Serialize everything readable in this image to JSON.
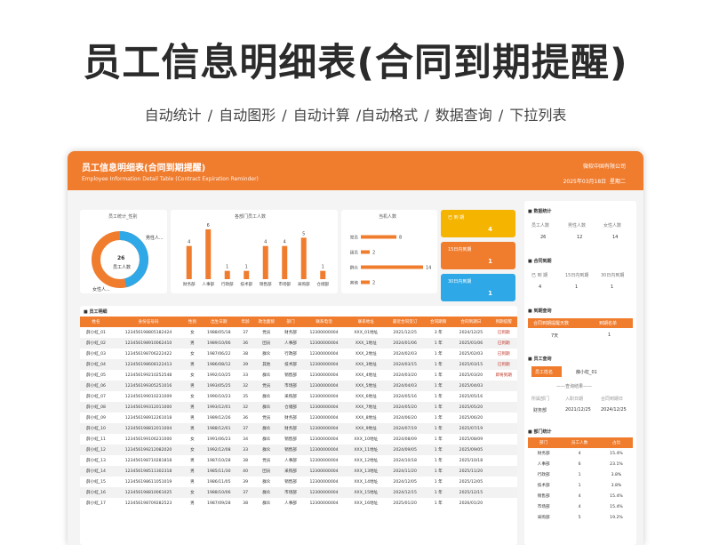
{
  "hero": {
    "title": "员工信息明细表(合同到期提醒)",
    "subtitle": "自动统计 / 自动图形 / 自动计算 /自动格式 / 数据查询 / 下拉列表"
  },
  "header": {
    "title": "员工信息明细表(合同到期提醒)",
    "subtitle": "Employee Information Detail Table (Contract Expiration Reminder)",
    "company": "微软中国有限公司",
    "date": "2025年03月18日",
    "weekday": "星期二"
  },
  "colors": {
    "accent": "#f07c2e",
    "blue": "#2ea8e6",
    "gold": "#f5b400"
  },
  "stats": {
    "gender": {
      "title": "员工统计_性别",
      "center_value": "26",
      "center_label": "员工人数",
      "male": "男性人...",
      "female": "女性人...",
      "male_count": 14,
      "female_count": 12
    },
    "dept": {
      "title": "各部门员工人数",
      "chart_data": {
        "type": "bar",
        "categories": [
          "财务部",
          "人事部",
          "行政部",
          "技术部",
          "销售部",
          "市场部",
          "采购部",
          "仓储部"
        ],
        "values": [
          4,
          6,
          1,
          1,
          4,
          4,
          5,
          1
        ]
      }
    },
    "intake": {
      "title": "当机人数",
      "chart_data": {
        "type": "bar",
        "orientation": "horizontal",
        "categories": [
          "党员",
          "团员",
          "群众",
          "其他"
        ],
        "values": [
          8,
          2,
          14,
          2
        ]
      }
    },
    "boxes": [
      {
        "label": "已 到 期",
        "value": "4"
      },
      {
        "label": "15日内到期",
        "value": "1"
      },
      {
        "label": "30日内到期",
        "value": "1"
      }
    ]
  },
  "table": {
    "title": "员工明细",
    "columns": [
      "姓名",
      "身份证号码",
      "性别",
      "出生日期",
      "年龄",
      "政治面貌",
      "部门",
      "联系电话",
      "联系地址",
      "最近合同签订",
      "合同期限",
      "合同到期日",
      "到期提醒"
    ],
    "rows": [
      [
        "薛小虹_01",
        "123456198805182424",
        "女",
        "1988/05/18",
        "37",
        "党员",
        "财务部",
        "12300000004",
        "XXX_01地址",
        "2021/12/25",
        "3 年",
        "2024/12/25",
        "已到期"
      ],
      [
        "薛小虹_02",
        "123456198910062410",
        "男",
        "1989/10/06",
        "36",
        "团员",
        "人事部",
        "12300000004",
        "XXX_1地址",
        "2024/01/06",
        "1 年",
        "2025/01/06",
        "已到期"
      ],
      [
        "薛小虹_03",
        "123456198706222422",
        "女",
        "1987/06/22",
        "38",
        "群众",
        "行政部",
        "12300000004",
        "XXX_2地址",
        "2024/02/03",
        "1 年",
        "2025/02/03",
        "已到期"
      ],
      [
        "薛小虹_04",
        "123456198608122413",
        "男",
        "1986/08/12",
        "39",
        "其他",
        "技术部",
        "12300000004",
        "XXX_3地址",
        "2024/03/15",
        "1 年",
        "2025/03/15",
        "已到期"
      ],
      [
        "薛小虹_05",
        "123456199210252548",
        "女",
        "1992/10/25",
        "33",
        "群众",
        "销售部",
        "12300000004",
        "XXX_4地址",
        "2024/03/20",
        "1 年",
        "2025/03/20",
        "即将到期"
      ],
      [
        "薛小虹_06",
        "123456199305251016",
        "男",
        "1993/05/25",
        "32",
        "党员",
        "市场部",
        "12300000004",
        "XXX_5地址",
        "2024/04/03",
        "1 年",
        "2025/04/03",
        ""
      ],
      [
        "薛小虹_07",
        "123456199010231009",
        "女",
        "1990/10/23",
        "35",
        "群众",
        "采购部",
        "12300000004",
        "XXX_6地址",
        "2024/05/16",
        "1 年",
        "2025/05/16",
        ""
      ],
      [
        "薛小虹_08",
        "123456199312011000",
        "男",
        "1993/12/01",
        "32",
        "群众",
        "仓储部",
        "12300000004",
        "XXX_7地址",
        "2024/05/20",
        "1 年",
        "2025/05/20",
        ""
      ],
      [
        "薛小虹_09",
        "123456198912261018",
        "男",
        "1989/12/26",
        "36",
        "党员",
        "财务部",
        "12300000004",
        "XXX_8地址",
        "2024/06/20",
        "1 年",
        "2025/06/20",
        ""
      ],
      [
        "薛小虹_10",
        "123456198812011004",
        "男",
        "1988/12/01",
        "37",
        "群众",
        "财务部",
        "12300000004",
        "XXX_9地址",
        "2024/07/19",
        "1 年",
        "2025/07/19",
        ""
      ],
      [
        "薛小虹_11",
        "123456199106231000",
        "女",
        "1991/06/23",
        "34",
        "群众",
        "销售部",
        "12300000004",
        "XXX_10地址",
        "2024/08/09",
        "1 年",
        "2025/08/09",
        ""
      ],
      [
        "薛小虹_12",
        "123456199212082020",
        "女",
        "1992/12/08",
        "33",
        "群众",
        "销售部",
        "12300000004",
        "XXX_11地址",
        "2024/09/05",
        "1 年",
        "2025/09/05",
        ""
      ],
      [
        "薛小虹_13",
        "123456198710281818",
        "男",
        "1987/10/28",
        "38",
        "党员",
        "人事部",
        "12300000004",
        "XXX_12地址",
        "2024/10/18",
        "1 年",
        "2025/10/18",
        ""
      ],
      [
        "薛小虹_14",
        "123456198511302318",
        "男",
        "1985/11/30",
        "40",
        "团员",
        "采购部",
        "12300000004",
        "XXX_13地址",
        "2024/11/20",
        "1 年",
        "2025/11/20",
        ""
      ],
      [
        "薛小虹_15",
        "123456198611051019",
        "男",
        "1986/11/05",
        "39",
        "群众",
        "销售部",
        "12300000004",
        "XXX_14地址",
        "2024/12/05",
        "1 年",
        "2025/12/05",
        ""
      ],
      [
        "薛小虹_16",
        "123456198810061025",
        "女",
        "1988/10/06",
        "37",
        "群众",
        "市场部",
        "12300000004",
        "XXX_15地址",
        "2024/12/15",
        "1 年",
        "2025/12/15",
        ""
      ],
      [
        "薛小虹_17",
        "123456198709282523",
        "男",
        "1987/09/28",
        "38",
        "群众",
        "人事部",
        "12300000004",
        "XXX_16地址",
        "2025/01/20",
        "1 年",
        "2026/01/20",
        ""
      ]
    ]
  },
  "side": {
    "count": {
      "title": "数据统计",
      "labels": [
        "员工人数",
        "男性人数",
        "女性人数"
      ],
      "values": [
        "26",
        "12",
        "14"
      ]
    },
    "contract": {
      "title": "合同到期",
      "labels": [
        "已 到 期",
        "15日内到期",
        "30日内到期"
      ],
      "values": [
        "4",
        "1",
        "1"
      ]
    },
    "query": {
      "title": "到期查询",
      "labels": [
        "合同到期提醒天数",
        "到期名单"
      ],
      "values": [
        "7天",
        "1"
      ]
    },
    "emp": {
      "title": "员工查询",
      "name_label": "员工姓名",
      "name_value": "薛小虹_01",
      "result": "——查询结果——",
      "labels": [
        "所属部门",
        "入职日期",
        "合同到期日"
      ],
      "values": [
        "财务部",
        "2021/12/25",
        "2024/12/25"
      ]
    },
    "depts": {
      "title": "部门统计",
      "columns": [
        "部门",
        "员工人数",
        "占比"
      ],
      "rows": [
        [
          "财务部",
          "4",
          "15.4%"
        ],
        [
          "人事部",
          "6",
          "23.1%"
        ],
        [
          "行政部",
          "1",
          "3.8%"
        ],
        [
          "技术部",
          "1",
          "3.8%"
        ],
        [
          "销售部",
          "4",
          "15.4%"
        ],
        [
          "市场部",
          "4",
          "15.4%"
        ],
        [
          "采购部",
          "5",
          "19.2%"
        ]
      ]
    }
  }
}
